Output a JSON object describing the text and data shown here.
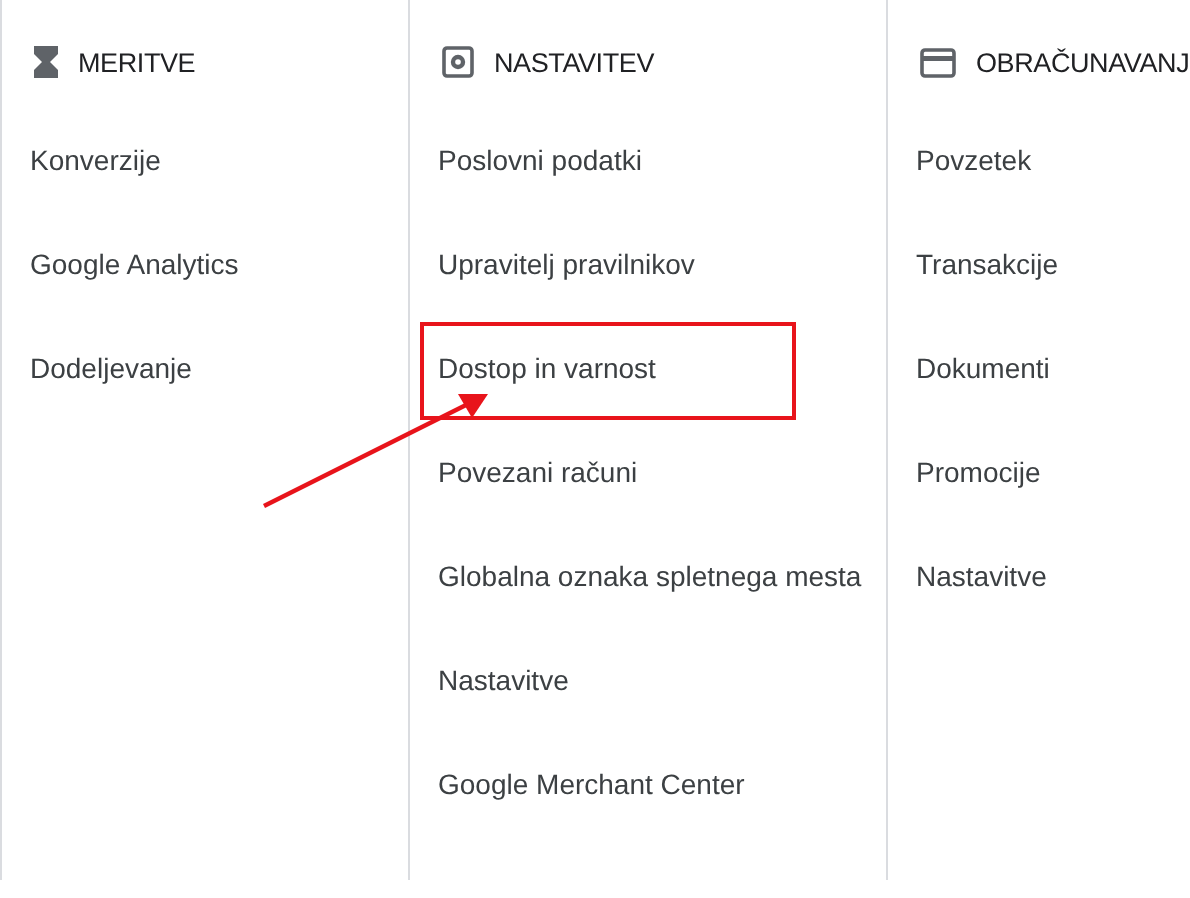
{
  "columns": [
    {
      "title": "MERITVE",
      "items": [
        {
          "label": "Konverzije",
          "highlighted": false
        },
        {
          "label": "Google Analytics",
          "highlighted": false
        },
        {
          "label": "Dodeljevanje",
          "highlighted": false
        }
      ]
    },
    {
      "title": "NASTAVITEV",
      "items": [
        {
          "label": "Poslovni podatki",
          "highlighted": false
        },
        {
          "label": "Upravitelj pravilnikov",
          "highlighted": false
        },
        {
          "label": "Dostop in varnost",
          "highlighted": true
        },
        {
          "label": "Povezani računi",
          "highlighted": false
        },
        {
          "label": "Globalna oznaka spletnega mesta",
          "highlighted": false
        },
        {
          "label": "Nastavitve",
          "highlighted": false
        },
        {
          "label": "Google Merchant Center",
          "highlighted": false
        }
      ]
    },
    {
      "title": "OBRAČUNAVANJ",
      "items": [
        {
          "label": "Povzetek",
          "highlighted": false
        },
        {
          "label": "Transakcije",
          "highlighted": false
        },
        {
          "label": "Dokumenti",
          "highlighted": false
        },
        {
          "label": "Promocije",
          "highlighted": false
        },
        {
          "label": "Nastavitve",
          "highlighted": false
        }
      ]
    }
  ]
}
